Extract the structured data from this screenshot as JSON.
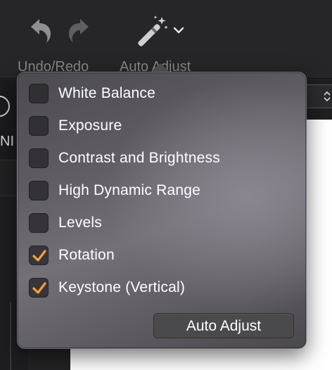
{
  "toolbar": {
    "undo_redo_label": "Undo/Redo",
    "auto_adjust_label": "Auto Adjust",
    "icon_color_dim": "#8a8a8d",
    "icon_color_bright": "#cfcfd2"
  },
  "popover": {
    "options": [
      {
        "label": "White Balance",
        "checked": false
      },
      {
        "label": "Exposure",
        "checked": false
      },
      {
        "label": "Contrast and Brightness",
        "checked": false
      },
      {
        "label": "High Dynamic Range",
        "checked": false
      },
      {
        "label": "Levels",
        "checked": false
      },
      {
        "label": "Rotation",
        "checked": true
      },
      {
        "label": "Keystone (Vertical)",
        "checked": true
      }
    ],
    "checkmark_color": "#f5a03a",
    "button_label": "Auto Adjust"
  }
}
